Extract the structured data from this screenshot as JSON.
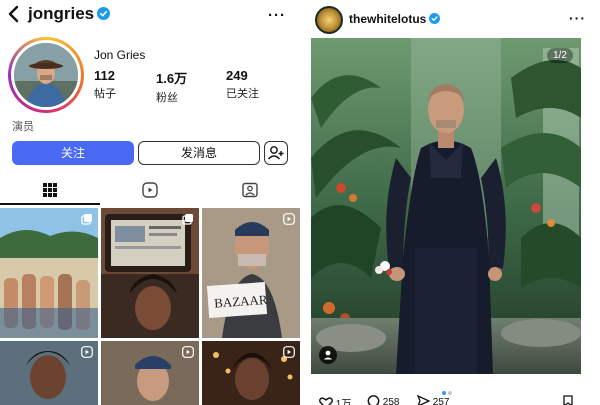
{
  "profile": {
    "username": "jongries",
    "full_name": "Jon Gries",
    "stats": [
      {
        "value": "112",
        "label": "帖子"
      },
      {
        "value": "1.6万",
        "label": "粉丝"
      },
      {
        "value": "249",
        "label": "已关注"
      }
    ],
    "bio": "演员",
    "follow_label": "关注",
    "message_label": "发消息"
  },
  "post": {
    "username": "thewhitelotus",
    "counter": "1/2",
    "likes": "1万",
    "comments": "258",
    "shares": "257"
  },
  "icons": {
    "back": "back-chevron-icon",
    "verified": "verified-badge-icon",
    "more": "more-options-icon",
    "add_friend": "add-person-icon",
    "grid": "grid-icon",
    "reels": "reels-icon",
    "tagged": "tagged-icon"
  },
  "colors": {
    "accent": "#4a69f5",
    "verified": "#1d9bf0"
  }
}
